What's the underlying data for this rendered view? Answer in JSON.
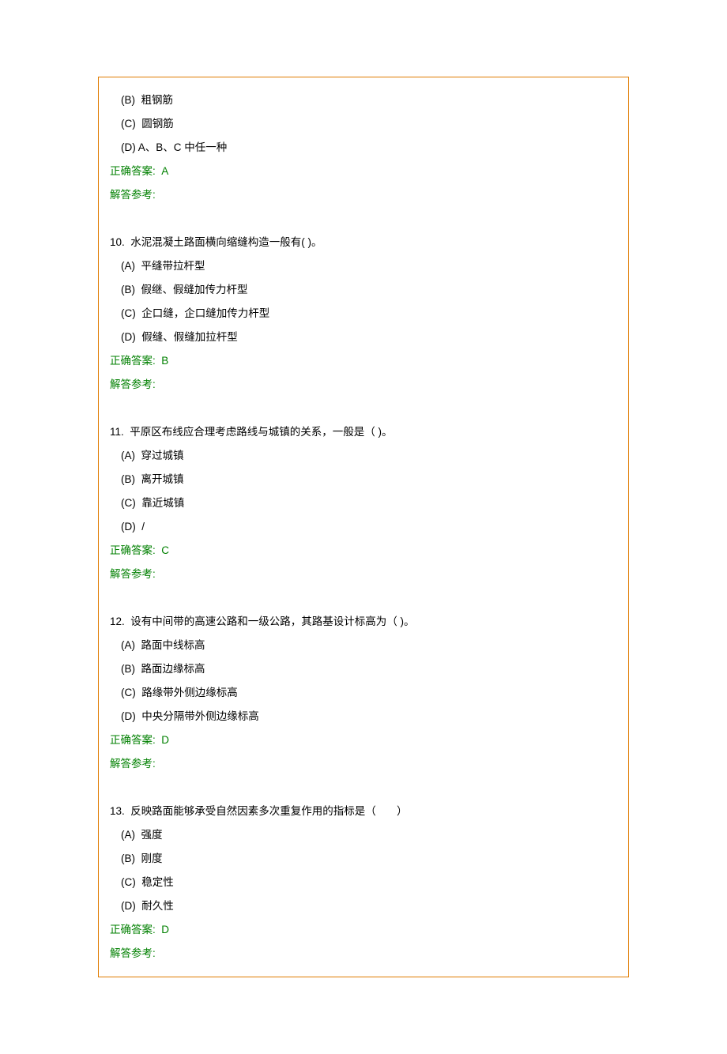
{
  "q9_tail": {
    "options": [
      {
        "label": "(B)  粗钢筋"
      },
      {
        "label": "(C)  圆钢筋"
      },
      {
        "label": "(D) A、B、C 中任一种"
      }
    ],
    "answer_label": "正确答案:  A",
    "ref_label": "解答参考:"
  },
  "questions": [
    {
      "stem": "10.  水泥混凝土路面横向缩缝构造一般有( )。",
      "options": [
        {
          "label": "(A)  平缝带拉杆型"
        },
        {
          "label": "(B)  假继、假缝加传力杆型"
        },
        {
          "label": "(C)  企口缝，企口缝加传力杆型"
        },
        {
          "label": "(D)  假缝、假缝加拉杆型"
        }
      ],
      "answer_label": "正确答案:  B",
      "ref_label": "解答参考:"
    },
    {
      "stem": "11.  平原区布线应合理考虑路线与城镇的关系，一般是（ )。",
      "options": [
        {
          "label": "(A)  穿过城镇"
        },
        {
          "label": "(B)  离开城镇"
        },
        {
          "label": "(C)  靠近城镇"
        },
        {
          "label": "(D)  /"
        }
      ],
      "answer_label": "正确答案:  C",
      "ref_label": "解答参考:"
    },
    {
      "stem": "12.  设有中间带的高速公路和一级公路，其路基设计标高为（ )。",
      "options": [
        {
          "label": "(A)  路面中线标高"
        },
        {
          "label": "(B)  路面边缘标高"
        },
        {
          "label": "(C)  路缘带外侧边缘标高"
        },
        {
          "label": "(D)  中央分隔带外侧边缘标高"
        }
      ],
      "answer_label": "正确答案:  D",
      "ref_label": "解答参考:"
    },
    {
      "stem": "13.  反映路面能够承受自然因素多次重复作用的指标是（       ）",
      "options": [
        {
          "label": "(A)  强度"
        },
        {
          "label": "(B)  刚度"
        },
        {
          "label": "(C)  稳定性"
        },
        {
          "label": "(D)  耐久性"
        }
      ],
      "answer_label": "正确答案:  D",
      "ref_label": "解答参考:"
    }
  ]
}
